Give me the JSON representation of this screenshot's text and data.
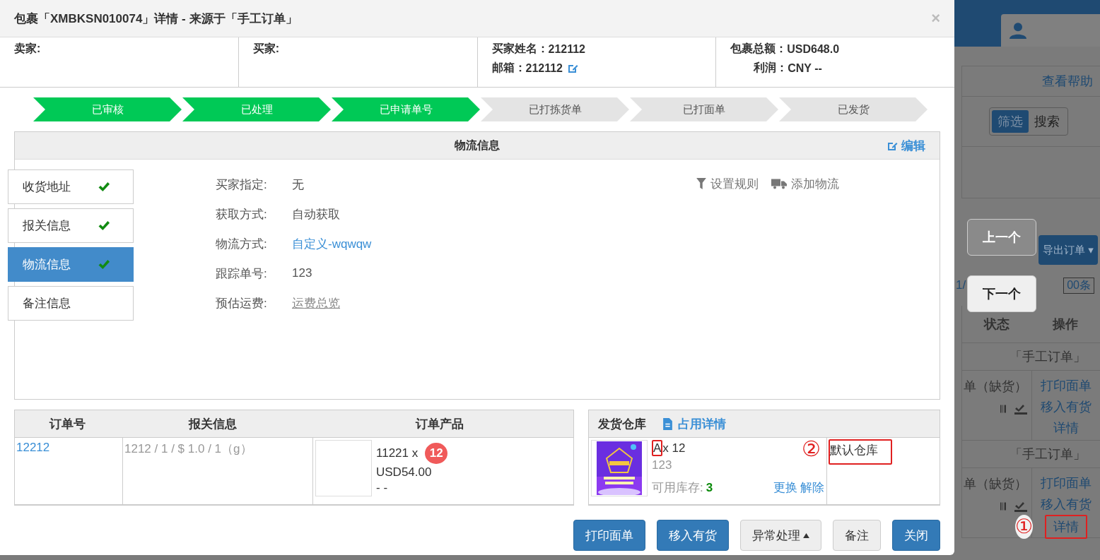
{
  "modal": {
    "title": "包裹「XMBKSN010074」详情 - 来源于「手工订单」",
    "close": "×"
  },
  "info": [
    {
      "label": "卖家:"
    },
    {
      "label": "买家:"
    },
    {
      "label": "买家姓名：",
      "value": "212112",
      "label2": "邮箱：",
      "value2": "212112"
    },
    {
      "label": "包裹总额：",
      "value": "USD648.0",
      "label2": "利润：",
      "value2": "CNY --"
    }
  ],
  "steps": [
    {
      "label": "已审核",
      "done": true
    },
    {
      "label": "已处理",
      "done": true
    },
    {
      "label": "已申请单号",
      "done": true
    },
    {
      "label": "已打拣货单",
      "done": false
    },
    {
      "label": "已打面单",
      "done": false
    },
    {
      "label": "已发货",
      "done": false
    }
  ],
  "logistics": {
    "title": "物流信息",
    "edit": "编辑",
    "nav": [
      {
        "label": "收货地址",
        "checked": true,
        "selected": false
      },
      {
        "label": "报关信息",
        "checked": true,
        "selected": false
      },
      {
        "label": "物流信息",
        "checked": true,
        "selected": true
      },
      {
        "label": "备注信息",
        "checked": false,
        "selected": false
      }
    ],
    "fields": [
      {
        "label": "买家指定:",
        "value": "无",
        "kind": "text"
      },
      {
        "label": "获取方式:",
        "value": "自动获取",
        "kind": "text"
      },
      {
        "label": "物流方式:",
        "value": "自定义-wqwqw",
        "kind": "link"
      },
      {
        "label": "跟踪单号:",
        "value": "123",
        "kind": "text"
      },
      {
        "label": "预估运费:",
        "value": "运费总览",
        "kind": "underline"
      }
    ],
    "actions": [
      "设置规则",
      "添加物流"
    ]
  },
  "order_table": {
    "columns": [
      "订单号",
      "报关信息",
      "订单产品"
    ],
    "order_no": "12212",
    "customs": "1212 / 1 / $ 1.0 / 1（g）",
    "product": "11221 x",
    "qty": "12",
    "price": "USD54.00",
    "extra": "- -"
  },
  "warehouse": {
    "title": "发货仓库",
    "detail_link": "占用详情",
    "sku": "A",
    "qty": "x 12",
    "code": "123",
    "stock_label": "可用库存:",
    "stock": "3",
    "change": "更换",
    "release": "解除",
    "marker": "②",
    "name": "默认仓库"
  },
  "footer": [
    {
      "label": "打印面单",
      "kind": "primary"
    },
    {
      "label": "移入有货",
      "kind": "primary"
    },
    {
      "label": "异常处理",
      "kind": "dropdown"
    },
    {
      "label": "备注",
      "kind": "default"
    },
    {
      "label": "关闭",
      "kind": "primary"
    }
  ],
  "background": {
    "help": "查看帮助",
    "toggle": [
      {
        "label": "筛选",
        "selected": true
      },
      {
        "label": "搜索",
        "selected": false
      }
    ],
    "export": "导出订单",
    "export_caret": "▾",
    "page": "1/",
    "page_size": "00条",
    "columns": [
      "状态",
      "操作"
    ],
    "groups": [
      {
        "source": "「手工订单」",
        "status": "单（缺货）",
        "links": [
          "打印面单",
          "移入有货",
          "详情"
        ]
      },
      {
        "source": "「手工订单」",
        "status": "单（缺货）",
        "links": [
          "打印面单",
          "移入有货",
          "详情"
        ],
        "marker": "①"
      }
    ]
  },
  "nav_buttons": [
    "上一个",
    "下一个"
  ]
}
